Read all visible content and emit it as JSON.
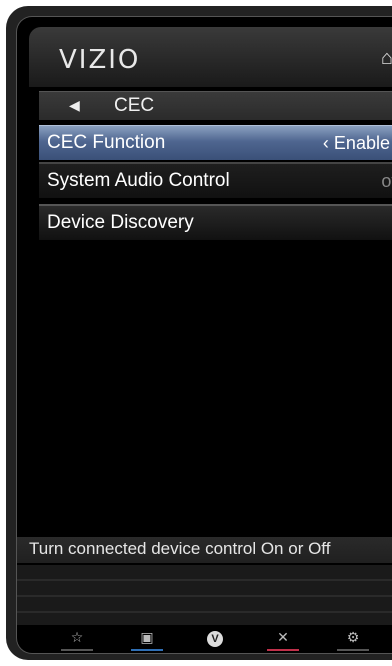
{
  "brand": {
    "logo": "VIZIO"
  },
  "header": {
    "home_icon": "home-icon"
  },
  "breadcrumb": {
    "back_icon": "back-arrow-icon",
    "title": "CEC"
  },
  "menu": {
    "items": [
      {
        "label": "CEC Function",
        "value": "Enable",
        "left_arrow": "‹",
        "right_arrow": "›",
        "selected": true
      },
      {
        "label": "System Audio Control",
        "value": "off"
      },
      {
        "label": "Device Discovery",
        "value": ""
      }
    ]
  },
  "help_text": "Turn connected device control On or Off",
  "bottom_bar": {
    "buttons": [
      {
        "icon": "star-icon",
        "color": "#555555"
      },
      {
        "icon": "input-icon",
        "color": "#2f6fb5"
      },
      {
        "icon": "vizio-v-icon",
        "color": "#333333"
      },
      {
        "icon": "close-icon",
        "color": "#c0304a"
      },
      {
        "icon": "settings-gear-icon",
        "color": "#555555"
      }
    ]
  }
}
